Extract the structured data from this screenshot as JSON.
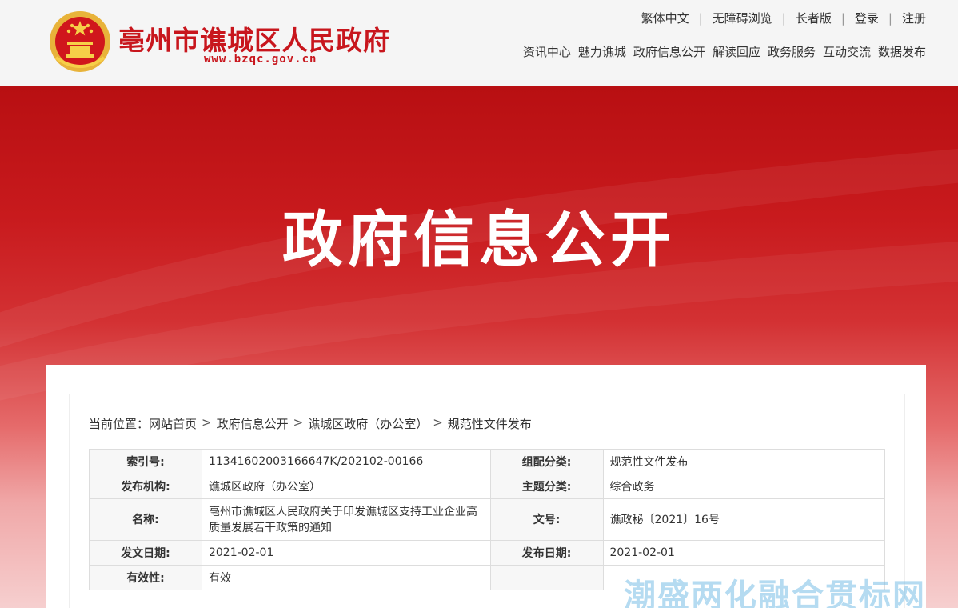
{
  "header": {
    "site_name": "亳州市谯城区人民政府",
    "site_url": "www.bzqc.gov.cn",
    "util_links": [
      "繁体中文",
      "无障碍浏览",
      "长者版",
      "登录",
      "注册"
    ],
    "nav": [
      "资讯中心",
      "魅力谯城",
      "政府信息公开",
      "解读回应",
      "政务服务",
      "互动交流",
      "数据发布"
    ]
  },
  "banner": {
    "title": "政府信息公开"
  },
  "breadcrumb": {
    "label": "当前位置：",
    "items": [
      "网站首页",
      "政府信息公开",
      "谯城区政府（办公室）",
      "规范性文件发布"
    ]
  },
  "meta": {
    "index_no_label": "索引号:",
    "index_no": "11341602003166647K/202102-00166",
    "category_label": "组配分类:",
    "category": "规范性文件发布",
    "publisher_label": "发布机构:",
    "publisher": "谯城区政府（办公室）",
    "topic_label": "主题分类:",
    "topic": "综合政务",
    "name_label": "名称:",
    "name": "亳州市谯城区人民政府关于印发谯城区支持工业企业高质量发展若干政策的通知",
    "doc_no_label": "文号:",
    "doc_no": "谯政秘〔2021〕16号",
    "issue_date_label": "发文日期:",
    "issue_date": "2021-02-01",
    "publish_date_label": "发布日期:",
    "publish_date": "2021-02-01",
    "validity_label": "有效性:",
    "validity": "有效"
  },
  "watermark": "潮盛两化融合贯标网",
  "colors": {
    "brand_red": "#c8161d",
    "banner_red": "#b80f12"
  }
}
